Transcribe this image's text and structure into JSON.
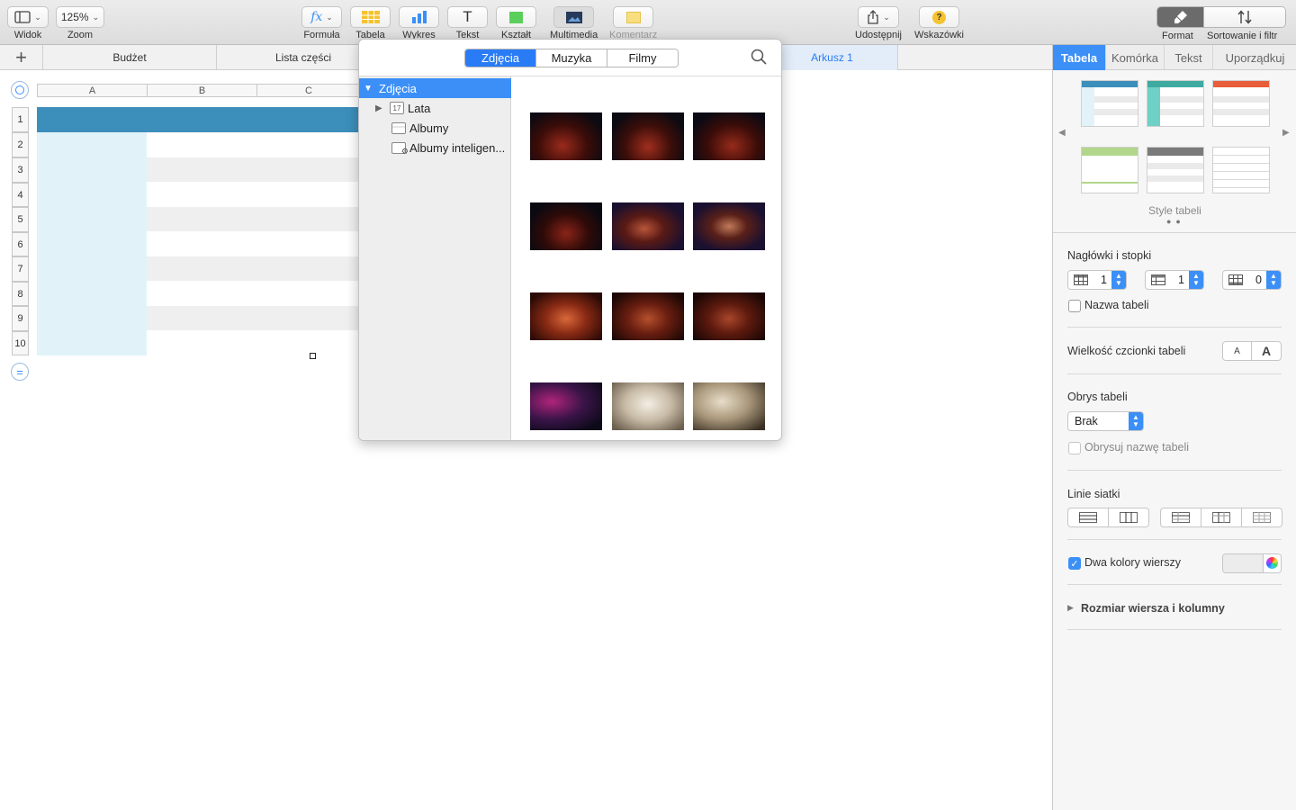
{
  "toolbar": {
    "view_label": "Widok",
    "zoom_value": "125%",
    "zoom_label": "Zoom",
    "formula_label": "Formuła",
    "table_label": "Tabela",
    "chart_label": "Wykres",
    "text_label": "Tekst",
    "shape_label": "Kształt",
    "media_label": "Multimedia",
    "comment_label": "Komentarz",
    "share_label": "Udostępnij",
    "tips_label": "Wskazówki",
    "format_label": "Format",
    "sort_label": "Sortowanie i filtr"
  },
  "sheet_tabs": [
    "Budżet",
    "Lista części",
    "Arkusz 1"
  ],
  "spreadsheet": {
    "columns": [
      "A",
      "B",
      "C"
    ],
    "rows": [
      "1",
      "2",
      "3",
      "4",
      "5",
      "6",
      "7",
      "8",
      "9",
      "10"
    ]
  },
  "media_popover": {
    "tabs": [
      "Zdjęcia",
      "Muzyka",
      "Filmy"
    ],
    "active_tab": "Zdjęcia",
    "sidebar": {
      "root": "Zdjęcia",
      "items": [
        "Lata",
        "Albumy",
        "Albumy inteligen..."
      ],
      "calendar_badge": "17"
    },
    "photo_count": 12
  },
  "inspector": {
    "tabs": [
      "Tabela",
      "Komórka",
      "Tekst",
      "Uporządkuj"
    ],
    "active_tab": "Tabela",
    "styles_label": "Style tabeli",
    "headers_title": "Nagłówki i stopki",
    "header_rows": "1",
    "header_cols": "1",
    "footer_rows": "0",
    "table_name_label": "Nazwa tabeli",
    "font_size_title": "Wielkość czcionki tabeli",
    "font_small": "A",
    "font_large": "A",
    "outline_title": "Obrys tabeli",
    "outline_value": "Brak",
    "outline_name_label": "Obrysuj nazwę tabeli",
    "gridlines_title": "Linie siatki",
    "alt_rows_label": "Dwa kolory wierszy",
    "row_col_size_label": "Rozmiar wiersza i kolumny"
  },
  "colors": {
    "accent": "#3b8ff7",
    "header_row": "#3c8ebb",
    "header_col": "#e1f3f9"
  }
}
